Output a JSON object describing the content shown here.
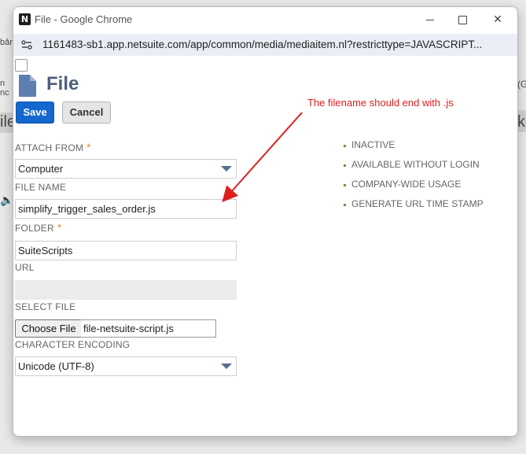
{
  "background": {
    "fragments": [
      "bản",
      "n nc",
      "ile",
      "(G",
      "kế"
    ]
  },
  "window": {
    "title": "File - Google Chrome",
    "app_icon_letter": "N",
    "controls": {
      "close_glyph": "✕"
    }
  },
  "address_bar": {
    "url": "1161483-sb1.app.netsuite.com/app/common/media/mediaitem.nl?restricttype=JAVASCRIPT..."
  },
  "page": {
    "title": "File",
    "buttons": {
      "save": "Save",
      "cancel": "Cancel"
    },
    "fields": {
      "attach_from": {
        "label": "ATTACH FROM",
        "required_mark": "*",
        "value": "Computer"
      },
      "file_name": {
        "label": "FILE NAME",
        "value": "simplify_trigger_sales_order.js"
      },
      "folder": {
        "label": "FOLDER",
        "required_mark": "*",
        "value": "SuiteScripts"
      },
      "url": {
        "label": "URL",
        "value": ""
      },
      "select_file": {
        "label": "SELECT FILE",
        "button": "Choose File",
        "chosen": "file-netsuite-script.js"
      },
      "character_encoding": {
        "label": "CHARACTER ENCODING",
        "value": "Unicode (UTF-8)"
      }
    },
    "options": [
      {
        "label": "INACTIVE"
      },
      {
        "label": "AVAILABLE WITHOUT LOGIN"
      },
      {
        "label": "COMPANY-WIDE USAGE"
      },
      {
        "label": "GENERATE URL TIME STAMP"
      }
    ]
  },
  "annotation": {
    "text": "The filename should end with .js",
    "color": "#e01e1e"
  },
  "colors": {
    "save_button": "#1467cc",
    "title_text": "#4d5f79",
    "required_star": "#d69b1e",
    "dropdown_arrow": "#5a6f8d"
  }
}
